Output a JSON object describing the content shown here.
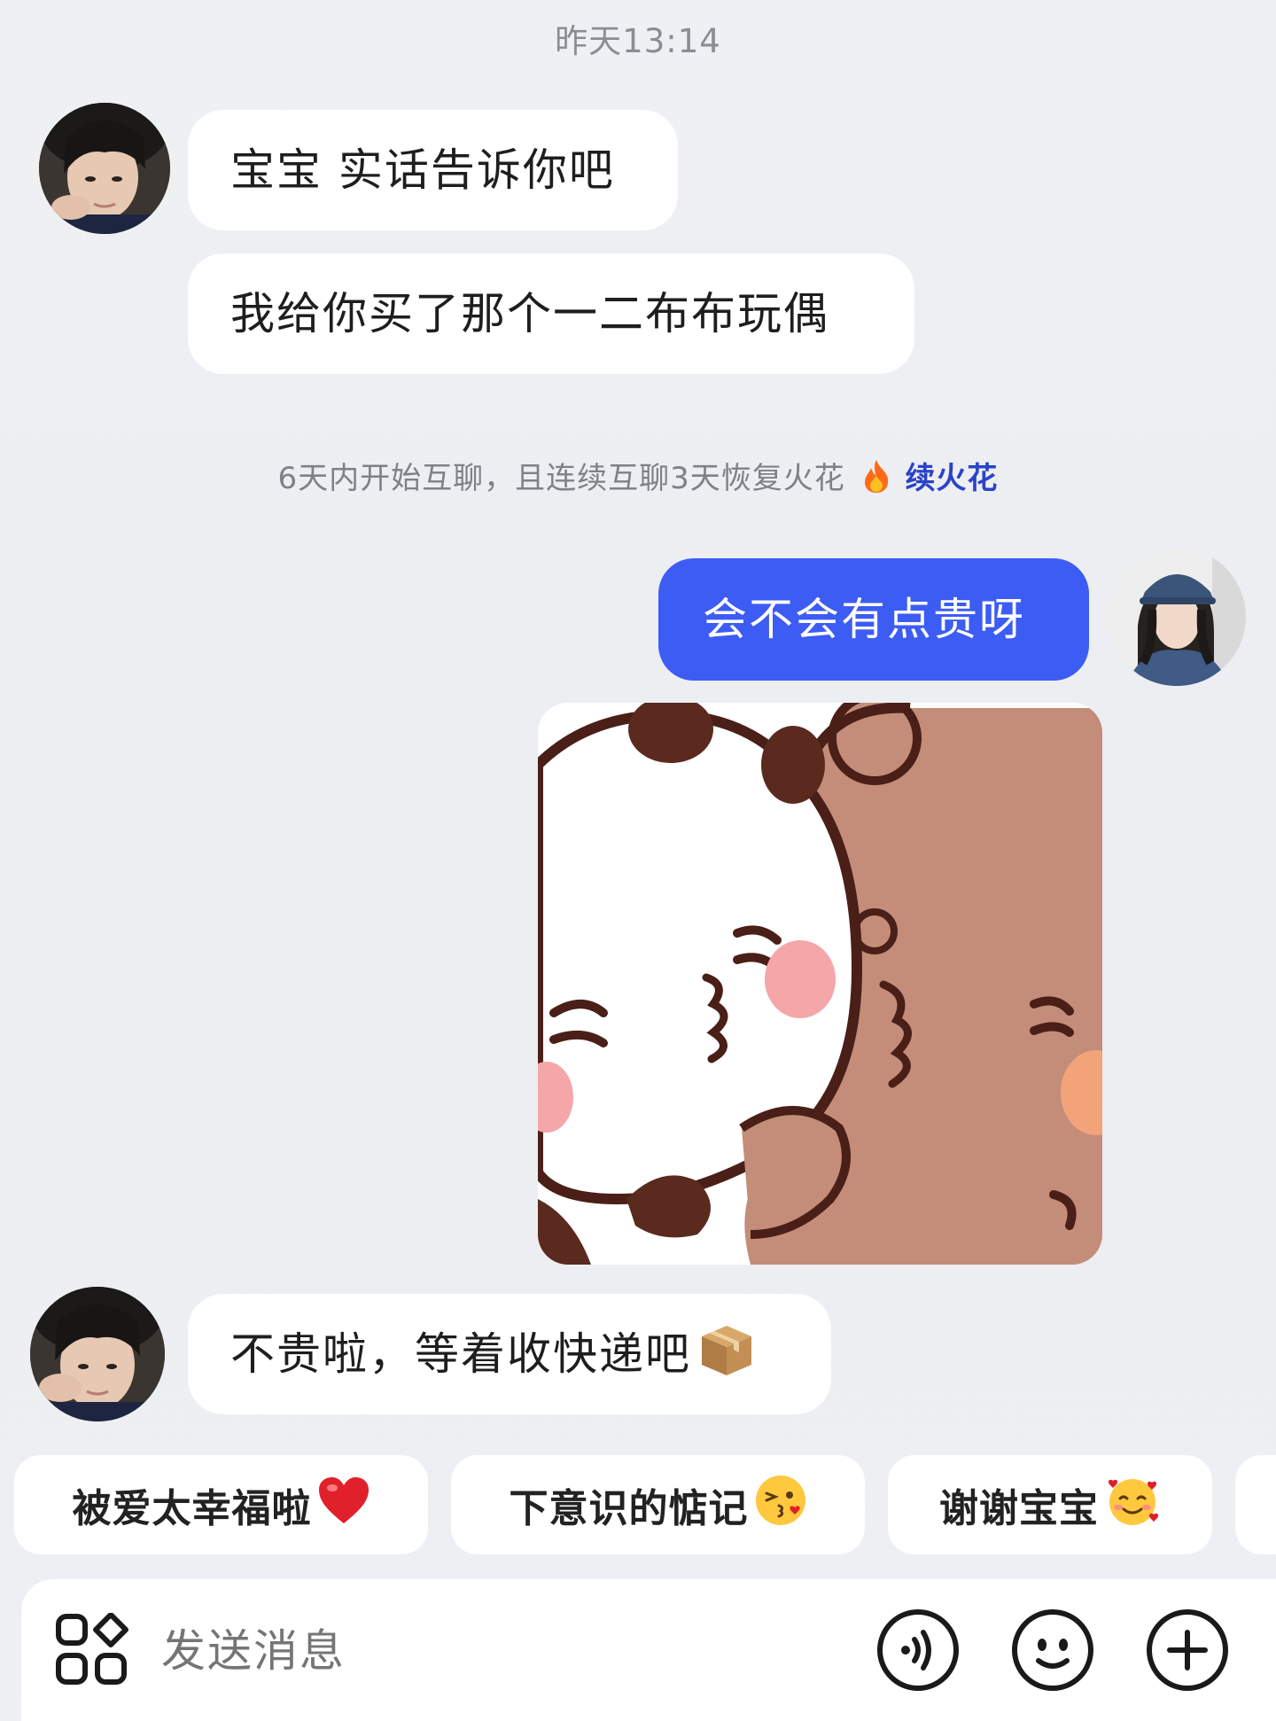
{
  "header": {
    "timestamp": "昨天13:14"
  },
  "messages": [
    {
      "sender": "other",
      "text": "宝宝 实话告诉你吧"
    },
    {
      "sender": "other",
      "text": "我给你买了那个一二布布玩偶"
    },
    {
      "sender": "me",
      "text": "会不会有点贵呀"
    },
    {
      "sender": "other",
      "text": "不贵啦，等着收快递吧"
    }
  ],
  "system_notice": {
    "text": "6天内开始互聊，且连续互聊3天恢复火花",
    "link_label": "续火花",
    "icon": "fire-icon"
  },
  "sticker": {
    "icon": "kissing-bears-sticker"
  },
  "message_emoji": {
    "icon": "package-icon"
  },
  "quick_replies": [
    {
      "label": "被爱太幸福啦",
      "icon": "red-heart-icon"
    },
    {
      "label": "下意识的惦记",
      "icon": "kissing-face-icon"
    },
    {
      "label": "谢谢宝宝",
      "icon": "smiling-face-with-hearts-icon"
    }
  ],
  "input": {
    "placeholder": "发送消息",
    "left_icon": "apps-grid-icon",
    "right_icons": [
      "voice-icon",
      "emoji-icon",
      "plus-icon"
    ]
  },
  "colors": {
    "background": "#eceef1",
    "bubble_other": "#ffffff",
    "bubble_mine": "#3c5cf4",
    "link": "#2b43c8"
  }
}
